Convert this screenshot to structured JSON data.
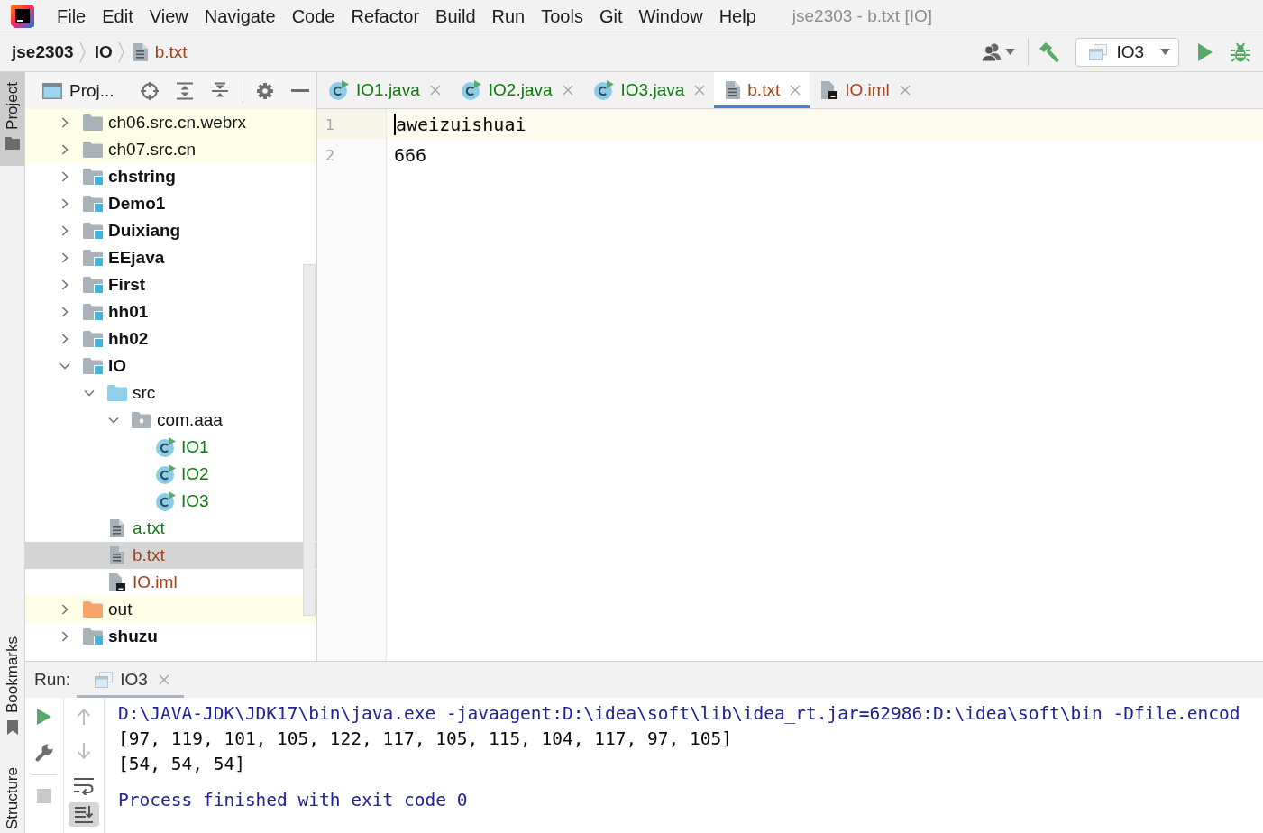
{
  "menu_bar": {
    "items": [
      "File",
      "Edit",
      "View",
      "Navigate",
      "Code",
      "Refactor",
      "Build",
      "Run",
      "Tools",
      "Git",
      "Window",
      "Help"
    ],
    "title": "jse2303 - b.txt [IO]"
  },
  "breadcrumb": [
    {
      "label": "jse2303",
      "kind": "folder"
    },
    {
      "label": "IO",
      "kind": "folder"
    },
    {
      "label": "b.txt",
      "kind": "file",
      "color": "#a0431c"
    }
  ],
  "toolbar": {
    "run_config": "IO3"
  },
  "tool_strip": {
    "top": [
      {
        "label": "Project",
        "kind": "project",
        "selected": true
      }
    ],
    "bottom": [
      {
        "label": "Bookmarks",
        "kind": "bookmarks",
        "selected": false
      },
      {
        "label": "Structure",
        "kind": "structure",
        "selected": false
      }
    ]
  },
  "project_panel": {
    "title": "Proj...",
    "tree": [
      {
        "name": "ch06.src.cn.webrx",
        "kind": "folder",
        "expanded": false,
        "highlighted": true,
        "selected": false
      },
      {
        "name": "ch07.src.cn",
        "kind": "folder",
        "expanded": false,
        "highlighted": true,
        "selected": false
      },
      {
        "name": "chstring",
        "kind": "module",
        "expanded": false,
        "highlighted": false,
        "selected": false
      },
      {
        "name": "Demo1",
        "kind": "module",
        "expanded": false,
        "highlighted": false,
        "selected": false
      },
      {
        "name": "Duixiang",
        "kind": "module",
        "expanded": false,
        "highlighted": false,
        "selected": false
      },
      {
        "name": "EEjava",
        "kind": "module",
        "expanded": false,
        "highlighted": false,
        "selected": false
      },
      {
        "name": "First",
        "kind": "module",
        "expanded": false,
        "highlighted": false,
        "selected": false
      },
      {
        "name": "hh01",
        "kind": "module",
        "expanded": false,
        "highlighted": false,
        "selected": false
      },
      {
        "name": "hh02",
        "kind": "module",
        "expanded": false,
        "highlighted": false,
        "selected": false
      },
      {
        "name": "IO",
        "kind": "module",
        "expanded": true,
        "highlighted": false,
        "selected": false,
        "children": [
          {
            "name": "src",
            "kind": "source",
            "expanded": true,
            "highlighted": false,
            "selected": false,
            "children": [
              {
                "name": "com.aaa",
                "kind": "package",
                "expanded": true,
                "highlighted": false,
                "selected": false,
                "children": [
                  {
                    "name": "IO1",
                    "kind": "class",
                    "color": "#0f7b0f",
                    "highlighted": false,
                    "selected": false
                  },
                  {
                    "name": "IO2",
                    "kind": "class",
                    "color": "#0f7b0f",
                    "highlighted": false,
                    "selected": false
                  },
                  {
                    "name": "IO3",
                    "kind": "class",
                    "color": "#0f7b0f",
                    "highlighted": false,
                    "selected": false
                  }
                ]
              }
            ]
          },
          {
            "name": "a.txt",
            "kind": "text",
            "color": "#0f7b0f",
            "highlighted": false,
            "selected": false
          },
          {
            "name": "b.txt",
            "kind": "text",
            "color": "#a0431c",
            "highlighted": false,
            "selected": true
          },
          {
            "name": "IO.iml",
            "kind": "iml",
            "color": "#a0431c",
            "highlighted": false,
            "selected": false
          }
        ]
      },
      {
        "name": "out",
        "kind": "excluded",
        "expanded": false,
        "highlighted": true,
        "selected": false
      },
      {
        "name": "shuzu",
        "kind": "module",
        "expanded": false,
        "highlighted": false,
        "selected": false
      }
    ]
  },
  "editor": {
    "tabs": [
      {
        "label": "IO1.java",
        "kind": "class",
        "color": "#0f7b0f",
        "selected": false
      },
      {
        "label": "IO2.java",
        "kind": "class",
        "color": "#0f7b0f",
        "selected": false
      },
      {
        "label": "IO3.java",
        "kind": "class",
        "color": "#0f7b0f",
        "selected": false
      },
      {
        "label": "b.txt",
        "kind": "text",
        "color": "#a0431c",
        "selected": true
      },
      {
        "label": "IO.iml",
        "kind": "iml",
        "color": "#a0431c",
        "selected": false
      }
    ],
    "lines": [
      {
        "number": "1",
        "text": "aweizuishuai",
        "current": true
      },
      {
        "number": "2",
        "text": "666",
        "current": false
      }
    ]
  },
  "run_panel": {
    "label": "Run:",
    "tabs": [
      {
        "label": "IO3",
        "selected": true
      }
    ],
    "actions": [
      {
        "kind": "rerun",
        "disabled": false
      },
      {
        "kind": "settings",
        "disabled": false
      },
      {
        "kind": "stop",
        "disabled": true
      }
    ],
    "console_actions": [
      {
        "kind": "up",
        "disabled": true,
        "selected": false
      },
      {
        "kind": "down",
        "disabled": true,
        "selected": false
      },
      {
        "kind": "wrap",
        "disabled": false,
        "selected": false
      },
      {
        "kind": "scroll_end",
        "disabled": false,
        "selected": true
      }
    ],
    "console": [
      {
        "text": "D:\\JAVA-JDK\\JDK17\\bin\\java.exe -javaagent:D:\\idea\\soft\\lib\\idea_rt.jar=62986:D:\\idea\\soft\\bin -Dfile.encod",
        "kind": "command"
      },
      {
        "text": "[97, 119, 101, 105, 122, 117, 105, 115, 104, 117, 97, 105]",
        "kind": "output"
      },
      {
        "text": "[54, 54, 54]",
        "kind": "output"
      },
      {
        "text": "Process finished with exit code 0",
        "kind": "exit"
      }
    ]
  }
}
